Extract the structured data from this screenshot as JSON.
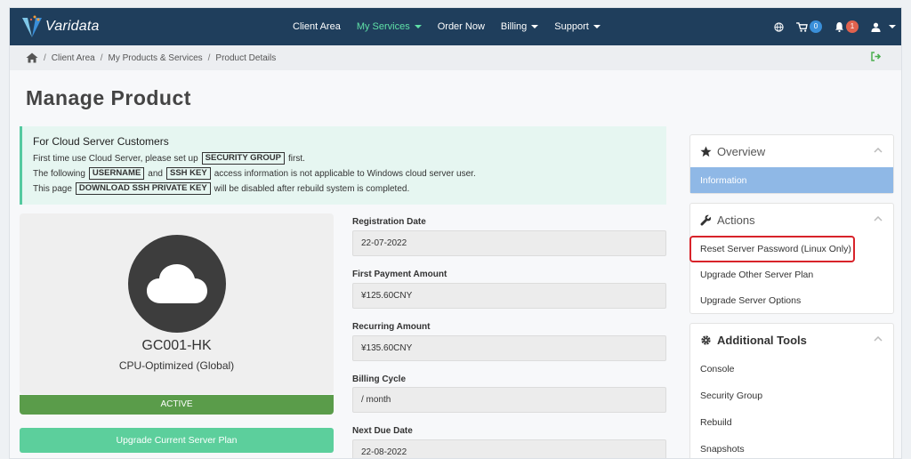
{
  "brand": {
    "name": "Varidata"
  },
  "nav": {
    "items": [
      {
        "label": "Client Area",
        "active": false,
        "dropdown": false
      },
      {
        "label": "My Services",
        "active": true,
        "dropdown": true
      },
      {
        "label": "Order Now",
        "active": false,
        "dropdown": false
      },
      {
        "label": "Billing",
        "active": false,
        "dropdown": true
      },
      {
        "label": "Support",
        "active": false,
        "dropdown": true
      }
    ],
    "cart_count": "0",
    "notification_count": "1"
  },
  "breadcrumb": [
    "Client Area",
    "My Products & Services",
    "Product Details"
  ],
  "page_title": "Manage Product",
  "alert": {
    "title": "For Cloud Server Customers",
    "line1_pre": "First time use Cloud Server, please set up",
    "line1_key": "SECURITY GROUP",
    "line1_post": "first.",
    "line2_pre": "The following",
    "line2_key1": "USERNAME",
    "line2_and": "and",
    "line2_key2": "SSH KEY",
    "line2_post": "access information is not applicable to Windows cloud server user.",
    "line3_pre": "This page",
    "line3_key": "DOWNLOAD SSH PRIVATE KEY",
    "line3_post": "will be disabled after rebuild system is completed."
  },
  "product": {
    "name": "GC001-HK",
    "type": "CPU-Optimized (Global)",
    "status": "ACTIVE",
    "upgrade_label": "Upgrade Current Server Plan"
  },
  "fields": [
    {
      "label": "Registration Date",
      "value": "22-07-2022"
    },
    {
      "label": "First Payment Amount",
      "value": "¥125.60CNY"
    },
    {
      "label": "Recurring Amount",
      "value": "¥135.60CNY"
    },
    {
      "label": "Billing Cycle",
      "value": "/ month"
    },
    {
      "label": "Next Due Date",
      "value": "22-08-2022"
    }
  ],
  "sidebar": {
    "overview": {
      "title": "Overview",
      "items": [
        "Information"
      ]
    },
    "actions": {
      "title": "Actions",
      "items": [
        "Reset Server Password (Linux Only)",
        "Upgrade Other Server Plan",
        "Upgrade Server Options"
      ]
    },
    "tools": {
      "title": "Additional Tools",
      "items": [
        "Console",
        "Security Group",
        "Rebuild",
        "Snapshots"
      ]
    }
  },
  "colors": {
    "navbar": "#1f3e5c",
    "accent": "#5fe0a7",
    "status": "#5a9c4a",
    "highlight": "#d8232a"
  }
}
